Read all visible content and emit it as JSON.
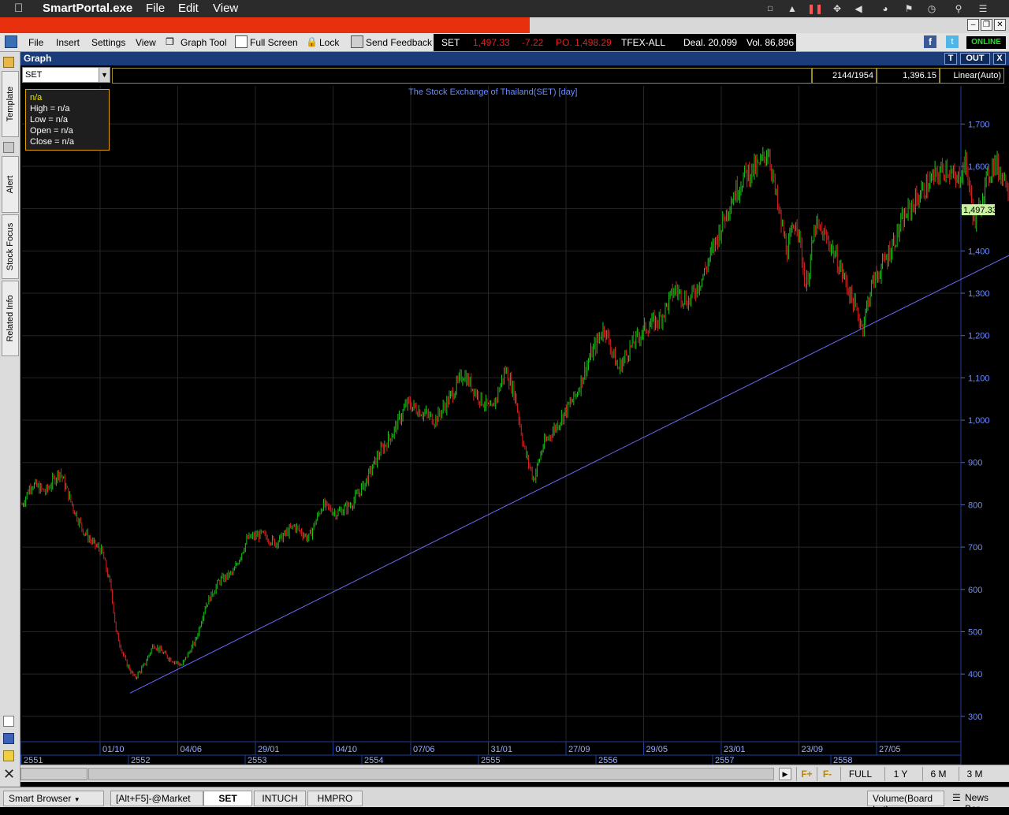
{
  "menubar": {
    "app_name": "SmartPortal.exe",
    "menus": [
      "File",
      "Edit",
      "View"
    ]
  },
  "toolbar": {
    "items": [
      "File",
      "Insert",
      "Settings",
      "View",
      "Graph Tool",
      "Full Screen",
      "Lock",
      "Send Feedback"
    ],
    "status": "ONLINE"
  },
  "ticker": {
    "symbol": "SET",
    "last": "1,497.33",
    "change": "-7.22",
    "po": "PO. 1,498.29",
    "market": "TFEX-ALL",
    "deal": "Deal. 20,099",
    "vol": "Vol. 86,896"
  },
  "sidetabs": [
    "Template",
    "Alert",
    "Stock Focus",
    "Related Info"
  ],
  "graph": {
    "title": "Graph",
    "btn_t": "T",
    "btn_out": "OUT",
    "btn_close": "X",
    "symbol": "SET",
    "bars_info": "2144/1954",
    "cursor_value": "1,396.15",
    "scale": "Linear(Auto)",
    "chart_title": "The Stock Exchange of Thailand(SET) [day]",
    "ohlc": {
      "title": "n/a",
      "high": "High  = n/a",
      "low": "Low  = n/a",
      "open": "Open  = n/a",
      "close": "Close  = n/a"
    },
    "last_price_tag": "1,497.33"
  },
  "bottom": {
    "buttons": [
      "FULL",
      "1 Y",
      "6 M",
      "3 M"
    ],
    "f_plus": "F+",
    "f_minus": "F-"
  },
  "taskbar": {
    "smart_browser": "Smart Browser",
    "tabs": [
      "[Alt+F5]-@Market",
      "SET",
      "INTUCH",
      "HMPRO"
    ],
    "volume": "Volume(Board Lot)",
    "news": "News Bar"
  },
  "colors": {
    "up": "#18c818",
    "down": "#e02020",
    "trendline": "#6a6aff",
    "axis_text": "#6c8cff",
    "grid": "#262626"
  },
  "chart_data": {
    "type": "candlestick",
    "title": "The Stock Exchange of Thailand(SET) [day]",
    "y_ticks": [
      300,
      400,
      500,
      600,
      700,
      800,
      900,
      1000,
      1100,
      1200,
      1300,
      1400,
      1500,
      1600,
      1700
    ],
    "ylim": [
      240,
      1790
    ],
    "x_date_labels": [
      "01/10",
      "04/06",
      "29/01",
      "04/10",
      "07/06",
      "31/01",
      "27/09",
      "29/05",
      "23/01",
      "23/09",
      "27/05"
    ],
    "x_year_labels": [
      "2551",
      "2552",
      "2553",
      "2554",
      "2555",
      "2556",
      "2557",
      "2558"
    ],
    "trendline": [
      [
        0.115,
        355
      ],
      [
        1.165,
        1515
      ]
    ],
    "close_series": [
      [
        0,
        800
      ],
      [
        0.01,
        850
      ],
      [
        0.025,
        830
      ],
      [
        0.04,
        880
      ],
      [
        0.055,
        790
      ],
      [
        0.065,
        740
      ],
      [
        0.075,
        710
      ],
      [
        0.085,
        690
      ],
      [
        0.095,
        600
      ],
      [
        0.1,
        500
      ],
      [
        0.11,
        430
      ],
      [
        0.12,
        390
      ],
      [
        0.13,
        420
      ],
      [
        0.14,
        470
      ],
      [
        0.155,
        440
      ],
      [
        0.17,
        420
      ],
      [
        0.185,
        480
      ],
      [
        0.195,
        560
      ],
      [
        0.21,
        620
      ],
      [
        0.225,
        640
      ],
      [
        0.24,
        720
      ],
      [
        0.255,
        730
      ],
      [
        0.27,
        710
      ],
      [
        0.29,
        750
      ],
      [
        0.305,
        720
      ],
      [
        0.32,
        800
      ],
      [
        0.335,
        780
      ],
      [
        0.35,
        800
      ],
      [
        0.365,
        850
      ],
      [
        0.38,
        920
      ],
      [
        0.395,
        970
      ],
      [
        0.41,
        1040
      ],
      [
        0.425,
        1020
      ],
      [
        0.44,
        1000
      ],
      [
        0.455,
        1050
      ],
      [
        0.47,
        1110
      ],
      [
        0.485,
        1060
      ],
      [
        0.5,
        1020
      ],
      [
        0.515,
        1120
      ],
      [
        0.525,
        1060
      ],
      [
        0.535,
        930
      ],
      [
        0.545,
        860
      ],
      [
        0.555,
        940
      ],
      [
        0.57,
        990
      ],
      [
        0.59,
        1060
      ],
      [
        0.605,
        1150
      ],
      [
        0.62,
        1220
      ],
      [
        0.635,
        1120
      ],
      [
        0.65,
        1180
      ],
      [
        0.665,
        1220
      ],
      [
        0.68,
        1240
      ],
      [
        0.695,
        1310
      ],
      [
        0.71,
        1280
      ],
      [
        0.725,
        1340
      ],
      [
        0.74,
        1430
      ],
      [
        0.755,
        1520
      ],
      [
        0.77,
        1580
      ],
      [
        0.785,
        1600
      ],
      [
        0.795,
        1640
      ],
      [
        0.805,
        1500
      ],
      [
        0.815,
        1400
      ],
      [
        0.825,
        1480
      ],
      [
        0.835,
        1310
      ],
      [
        0.845,
        1460
      ],
      [
        0.86,
        1420
      ],
      [
        0.875,
        1340
      ],
      [
        0.885,
        1280
      ],
      [
        0.895,
        1220
      ],
      [
        0.905,
        1320
      ],
      [
        0.92,
        1380
      ],
      [
        0.94,
        1480
      ],
      [
        0.955,
        1530
      ],
      [
        0.97,
        1570
      ],
      [
        0.985,
        1600
      ],
      [
        0.995,
        1560
      ],
      [
        1.005,
        1610
      ],
      [
        1.015,
        1460
      ],
      [
        1.025,
        1550
      ],
      [
        1.035,
        1610
      ],
      [
        1.05,
        1560
      ],
      [
        1.065,
        1510
      ],
      [
        1.08,
        1490
      ],
      [
        1.095,
        1500
      ]
    ]
  }
}
